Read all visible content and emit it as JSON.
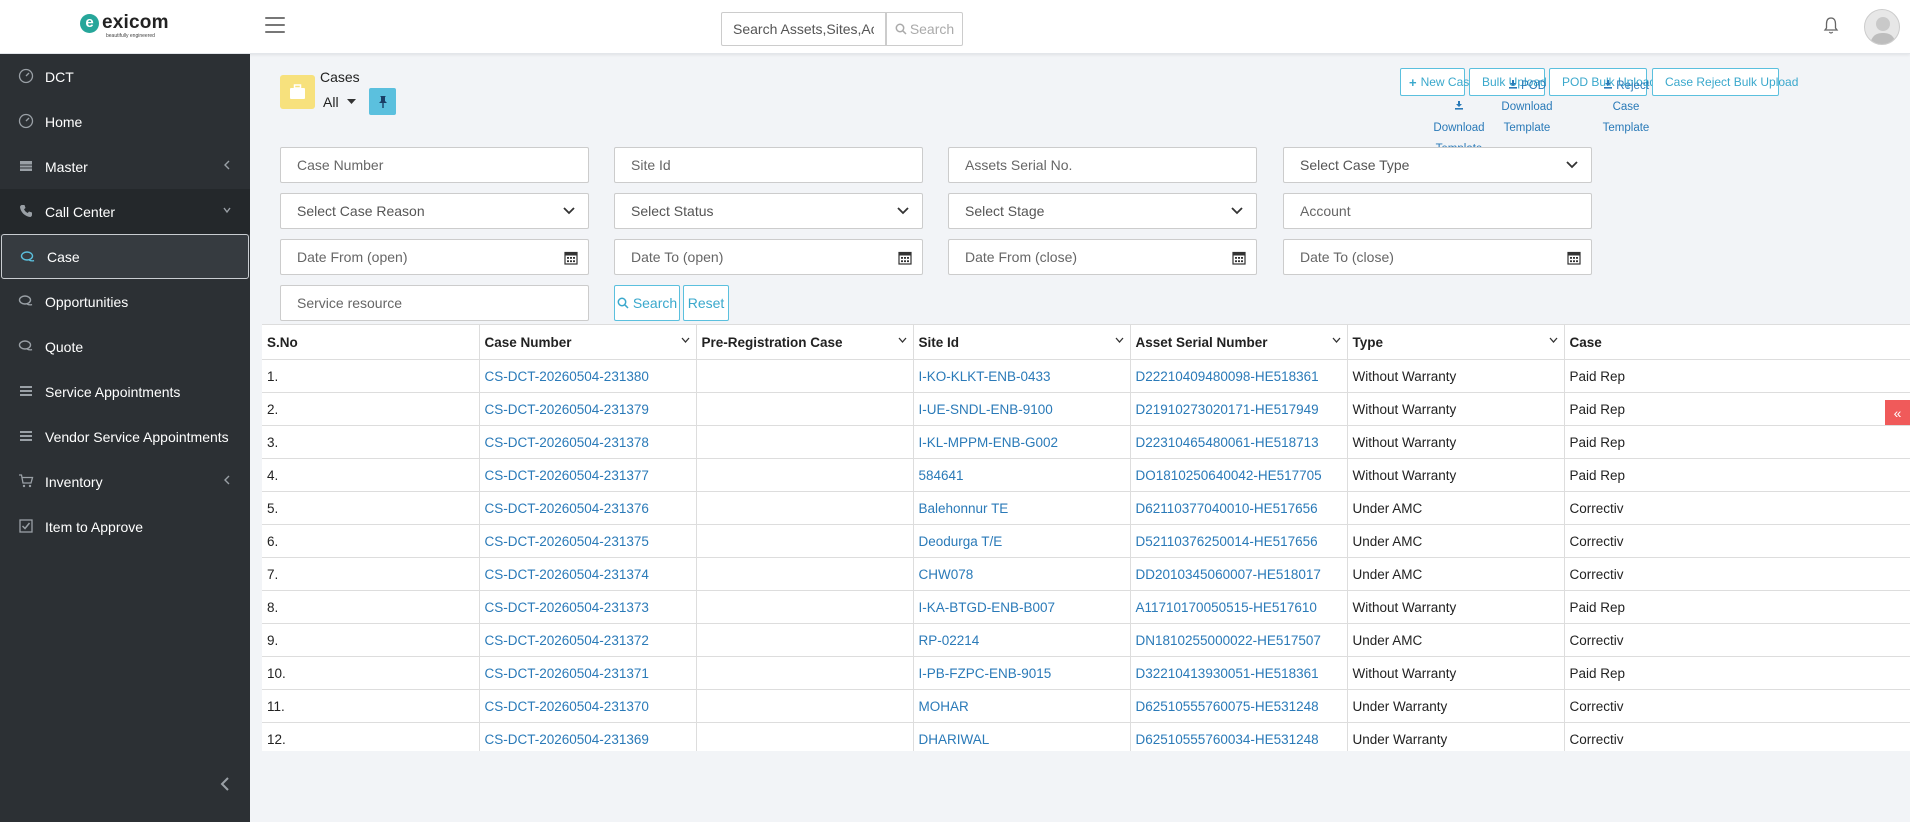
{
  "header": {
    "logo_text": "exicom",
    "logo_mark": "e",
    "logo_tagline": "beautifully engineered",
    "search_placeholder": "Search Assets,Sites,Accounts",
    "search_button": "Search",
    "icons": {
      "menu": "hamburger-icon",
      "bell": "bell-icon",
      "avatar": "user-avatar"
    }
  },
  "sidebar": {
    "items": [
      {
        "label": "DCT",
        "icon": "gauge-icon"
      },
      {
        "label": "Home",
        "icon": "gauge-icon"
      },
      {
        "label": "Master",
        "icon": "table-icon",
        "chevron": "left"
      },
      {
        "label": "Call Center",
        "icon": "phone-icon",
        "chevron": "down"
      },
      {
        "label": "Case",
        "icon": "chat-icon"
      },
      {
        "label": "Opportunities",
        "icon": "chat-icon"
      },
      {
        "label": "Quote",
        "icon": "chat-icon"
      },
      {
        "label": "Service Appointments",
        "icon": "list-icon"
      },
      {
        "label": "Vendor Service Appointments",
        "icon": "list-icon"
      },
      {
        "label": "Inventory",
        "icon": "cart-icon",
        "chevron": "left"
      },
      {
        "label": "Item to Approve",
        "icon": "checkbox-icon"
      }
    ],
    "active": "Case"
  },
  "page": {
    "title": "Cases",
    "view": "All",
    "buttons": {
      "new_case": "New Case",
      "bulk_upload": "Bulk Upload",
      "pod_bulk_upload": "POD Bulk Upload",
      "case_reject_bulk_upload": "Case Reject Bulk Upload"
    },
    "templates": {
      "download": [
        "Download",
        "Template"
      ],
      "pod": [
        "POD",
        "Download",
        "Template"
      ],
      "reject": [
        "Reject Case",
        "Template"
      ]
    }
  },
  "filters": {
    "case_number": "Case Number",
    "site_id": "Site Id",
    "assets_serial": "Assets Serial No.",
    "case_type": "Select Case Type",
    "case_reason": "Select Case Reason",
    "status": "Select Status",
    "stage": "Select Stage",
    "account": "Account",
    "date_from_open": "Date From (open)",
    "date_to_open": "Date To (open)",
    "date_from_close": "Date From (close)",
    "date_to_close": "Date To (close)",
    "service_resource": "Service resource",
    "search_button": "Search",
    "reset_button": "Reset"
  },
  "table": {
    "columns": [
      "S.No",
      "Case Number",
      "Pre-Registration Case",
      "Site Id",
      "Asset Serial Number",
      "Type",
      "Case"
    ],
    "rows": [
      [
        "1.",
        "CS-DCT-20260504-231380",
        "",
        "I-KO-KLKT-ENB-0433",
        "D22210409480098-HE518361",
        "Without Warranty",
        "Paid Rep"
      ],
      [
        "2.",
        "CS-DCT-20260504-231379",
        "",
        "I-UE-SNDL-ENB-9100",
        "D21910273020171-HE517949",
        "Without Warranty",
        "Paid Rep"
      ],
      [
        "3.",
        "CS-DCT-20260504-231378",
        "",
        "I-KL-MPPM-ENB-G002",
        "D22310465480061-HE518713",
        "Without Warranty",
        "Paid Rep"
      ],
      [
        "4.",
        "CS-DCT-20260504-231377",
        "",
        "584641",
        "DO1810250640042-HE517705",
        "Without Warranty",
        "Paid Rep"
      ],
      [
        "5.",
        "CS-DCT-20260504-231376",
        "",
        "Balehonnur TE",
        "D62110377040010-HE517656",
        "Under AMC",
        "Correctiv"
      ],
      [
        "6.",
        "CS-DCT-20260504-231375",
        "",
        "Deodurga T/E",
        "D52110376250014-HE517656",
        "Under AMC",
        "Correctiv"
      ],
      [
        "7.",
        "CS-DCT-20260504-231374",
        "",
        "CHW078",
        "DD2010345060007-HE518017",
        "Under AMC",
        "Correctiv"
      ],
      [
        "8.",
        "CS-DCT-20260504-231373",
        "",
        "I-KA-BTGD-ENB-B007",
        "A11710170050515-HE517610",
        "Without Warranty",
        "Paid Rep"
      ],
      [
        "9.",
        "CS-DCT-20260504-231372",
        "",
        "RP-02214",
        "DN1810255000022-HE517507",
        "Under AMC",
        "Correctiv"
      ],
      [
        "10.",
        "CS-DCT-20260504-231371",
        "",
        "I-PB-FZPC-ENB-9015",
        "D32210413930051-HE518361",
        "Without Warranty",
        "Paid Rep"
      ],
      [
        "11.",
        "CS-DCT-20260504-231370",
        "",
        "MOHAR",
        "D62510555760075-HE531248",
        "Under Warranty",
        "Correctiv"
      ],
      [
        "12.",
        "CS-DCT-20260504-231369",
        "",
        "DHARIWAL",
        "D62510555760034-HE531248",
        "Under Warranty",
        "Correctiv"
      ]
    ]
  },
  "collapse_tab": "«",
  "colors": {
    "sidebar_bg": "#2c3034",
    "accent": "#5bc0de",
    "link": "#2a7ab8",
    "collapse_tab": "#f05a5a",
    "page_icon": "#f7e17d"
  }
}
